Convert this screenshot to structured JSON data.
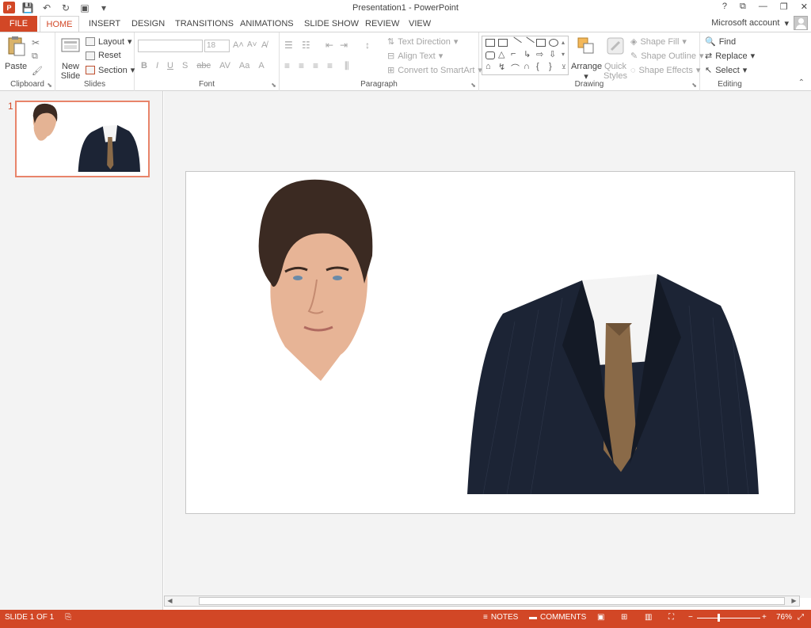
{
  "app": {
    "title": "Presentation1 - PowerPoint",
    "account": "Microsoft account",
    "window_controls": [
      "?",
      "⧉",
      "—",
      "❐",
      "✕"
    ]
  },
  "tabs": [
    "FILE",
    "HOME",
    "INSERT",
    "DESIGN",
    "TRANSITIONS",
    "ANIMATIONS",
    "SLIDE SHOW",
    "REVIEW",
    "VIEW"
  ],
  "ribbon": {
    "clipboard": {
      "paste": "Paste",
      "label": "Clipboard"
    },
    "slides": {
      "new_slide_1": "New",
      "new_slide_2": "Slide",
      "layout": "Layout",
      "reset": "Reset",
      "section": "Section",
      "label": "Slides"
    },
    "font": {
      "size": "18",
      "label": "Font",
      "bold": "B",
      "italic": "I",
      "underline": "U",
      "shadow": "S",
      "strike": "abc",
      "spacing": "AV",
      "case": "Aa",
      "color": "A"
    },
    "paragraph": {
      "text_direction": "Text Direction",
      "align_text": "Align Text",
      "smartart": "Convert to SmartArt",
      "label": "Paragraph"
    },
    "drawing": {
      "arrange": "Arrange",
      "quick_styles_1": "Quick",
      "quick_styles_2": "Styles",
      "shape_fill": "Shape Fill",
      "shape_outline": "Shape Outline",
      "shape_effects": "Shape Effects",
      "label": "Drawing"
    },
    "editing": {
      "find": "Find",
      "replace": "Replace",
      "select": "Select",
      "label": "Editing"
    }
  },
  "thumbnails": [
    {
      "number": "1"
    }
  ],
  "status": {
    "slide_info": "SLIDE 1 OF 1",
    "notes": "NOTES",
    "comments": "COMMENTS",
    "zoom": "76%"
  },
  "colors": {
    "accent": "#d24726",
    "suit": "#1c2435",
    "tie": "#8a6a48"
  }
}
